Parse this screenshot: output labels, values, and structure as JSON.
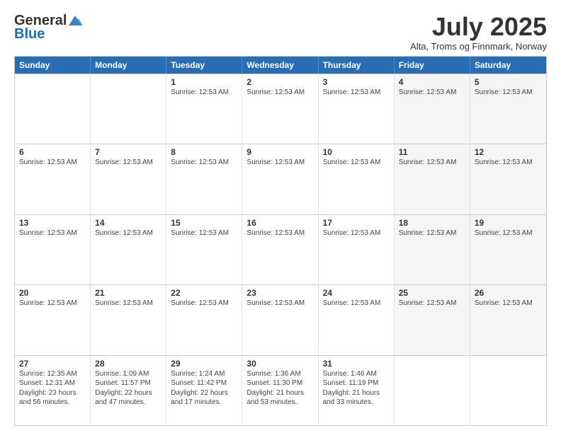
{
  "header": {
    "logo_general": "General",
    "logo_blue": "Blue",
    "month_title": "July 2025",
    "location": "Alta, Troms og Finnmark, Norway"
  },
  "weekdays": [
    "Sunday",
    "Monday",
    "Tuesday",
    "Wednesday",
    "Thursday",
    "Friday",
    "Saturday"
  ],
  "weeks": [
    [
      {
        "day": "",
        "info": "",
        "alt": false,
        "empty": true
      },
      {
        "day": "",
        "info": "",
        "alt": false,
        "empty": true
      },
      {
        "day": "1",
        "info": "Sunrise: 12:53 AM",
        "alt": false
      },
      {
        "day": "2",
        "info": "Sunrise: 12:53 AM",
        "alt": false
      },
      {
        "day": "3",
        "info": "Sunrise: 12:53 AM",
        "alt": false
      },
      {
        "day": "4",
        "info": "Sunrise: 12:53 AM",
        "alt": true
      },
      {
        "day": "5",
        "info": "Sunrise: 12:53 AM",
        "alt": true
      }
    ],
    [
      {
        "day": "6",
        "info": "Sunrise: 12:53 AM",
        "alt": false
      },
      {
        "day": "7",
        "info": "Sunrise: 12:53 AM",
        "alt": false
      },
      {
        "day": "8",
        "info": "Sunrise: 12:53 AM",
        "alt": false
      },
      {
        "day": "9",
        "info": "Sunrise: 12:53 AM",
        "alt": false
      },
      {
        "day": "10",
        "info": "Sunrise: 12:53 AM",
        "alt": false
      },
      {
        "day": "11",
        "info": "Sunrise: 12:53 AM",
        "alt": true
      },
      {
        "day": "12",
        "info": "Sunrise: 12:53 AM",
        "alt": true
      }
    ],
    [
      {
        "day": "13",
        "info": "Sunrise: 12:53 AM",
        "alt": false
      },
      {
        "day": "14",
        "info": "Sunrise: 12:53 AM",
        "alt": false
      },
      {
        "day": "15",
        "info": "Sunrise: 12:53 AM",
        "alt": false
      },
      {
        "day": "16",
        "info": "Sunrise: 12:53 AM",
        "alt": false
      },
      {
        "day": "17",
        "info": "Sunrise: 12:53 AM",
        "alt": false
      },
      {
        "day": "18",
        "info": "Sunrise: 12:53 AM",
        "alt": true
      },
      {
        "day": "19",
        "info": "Sunrise: 12:53 AM",
        "alt": true
      }
    ],
    [
      {
        "day": "20",
        "info": "Sunrise: 12:53 AM",
        "alt": false
      },
      {
        "day": "21",
        "info": "Sunrise: 12:53 AM",
        "alt": false
      },
      {
        "day": "22",
        "info": "Sunrise: 12:53 AM",
        "alt": false
      },
      {
        "day": "23",
        "info": "Sunrise: 12:53 AM",
        "alt": false
      },
      {
        "day": "24",
        "info": "Sunrise: 12:53 AM",
        "alt": false
      },
      {
        "day": "25",
        "info": "Sunrise: 12:53 AM",
        "alt": true
      },
      {
        "day": "26",
        "info": "Sunrise: 12:53 AM",
        "alt": true
      }
    ],
    [
      {
        "day": "27",
        "info": "Sunrise: 12:35 AM\nSunset: 12:31 AM\nDaylight: 23 hours and 56 minutes.",
        "alt": false
      },
      {
        "day": "28",
        "info": "Sunrise: 1:09 AM\nSunset: 11:57 PM\nDaylight: 22 hours and 47 minutes.",
        "alt": false
      },
      {
        "day": "29",
        "info": "Sunrise: 1:24 AM\nSunset: 11:42 PM\nDaylight: 22 hours and 17 minutes.",
        "alt": false
      },
      {
        "day": "30",
        "info": "Sunrise: 1:36 AM\nSunset: 11:30 PM\nDaylight: 21 hours and 53 minutes.",
        "alt": false
      },
      {
        "day": "31",
        "info": "Sunrise: 1:46 AM\nSunset: 11:19 PM\nDaylight: 21 hours and 33 minutes.",
        "alt": false
      },
      {
        "day": "",
        "info": "",
        "alt": true,
        "empty": true
      },
      {
        "day": "",
        "info": "",
        "alt": true,
        "empty": true
      }
    ]
  ]
}
